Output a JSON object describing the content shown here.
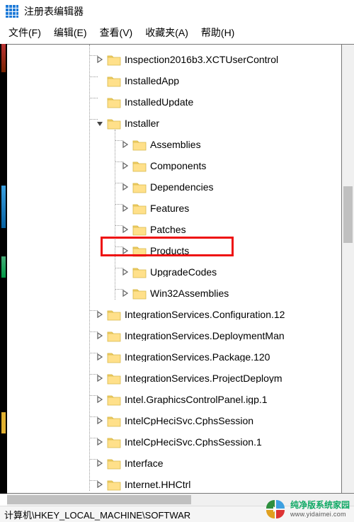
{
  "titlebar": {
    "title": "注册表编辑器"
  },
  "menu": {
    "file": "文件(F)",
    "edit": "编辑(E)",
    "view": "查看(V)",
    "favorites": "收藏夹(A)",
    "help": "帮助(H)"
  },
  "tree": {
    "level0": [
      {
        "label": "Inspection2016b3.XCTUserControl",
        "expander": "closed",
        "indent": 124
      },
      {
        "label": "InstalledApp",
        "expander": "leaf",
        "indent": 124
      },
      {
        "label": "InstalledUpdate",
        "expander": "leaf",
        "indent": 124
      },
      {
        "label": "Installer",
        "expander": "open",
        "indent": 124
      }
    ],
    "installerChildren": [
      {
        "label": "Assemblies",
        "expander": "closed",
        "indent": 160
      },
      {
        "label": "Components",
        "expander": "closed",
        "indent": 160
      },
      {
        "label": "Dependencies",
        "expander": "closed",
        "indent": 160
      },
      {
        "label": "Features",
        "expander": "closed",
        "indent": 160
      },
      {
        "label": "Patches",
        "expander": "closed",
        "indent": 160
      },
      {
        "label": "Products",
        "expander": "closed",
        "indent": 160,
        "highlight": true
      },
      {
        "label": "UpgradeCodes",
        "expander": "closed",
        "indent": 160
      },
      {
        "label": "Win32Assemblies",
        "expander": "closed",
        "indent": 160
      }
    ],
    "after": [
      {
        "label": "IntegrationServices.Configuration.12",
        "expander": "closed",
        "indent": 124
      },
      {
        "label": "IntegrationServices.DeploymentMan",
        "expander": "closed",
        "indent": 124
      },
      {
        "label": "IntegrationServices.Package.120",
        "expander": "closed",
        "indent": 124
      },
      {
        "label": "IntegrationServices.ProjectDeploym",
        "expander": "closed",
        "indent": 124
      },
      {
        "label": "Intel.GraphicsControlPanel.igp.1",
        "expander": "closed",
        "indent": 124
      },
      {
        "label": "IntelCpHeciSvc.CphsSession",
        "expander": "closed",
        "indent": 124
      },
      {
        "label": "IntelCpHeciSvc.CphsSession.1",
        "expander": "closed",
        "indent": 124
      },
      {
        "label": "Interface",
        "expander": "closed",
        "indent": 124
      },
      {
        "label": "Internet.HHCtrl",
        "expander": "closed",
        "indent": 124
      }
    ]
  },
  "statusbar": {
    "path": "计算机\\HKEY_LOCAL_MACHINE\\SOFTWAR"
  },
  "watermark": {
    "line1": "纯净版系统家园",
    "line2": "www.yidaimei.com"
  }
}
